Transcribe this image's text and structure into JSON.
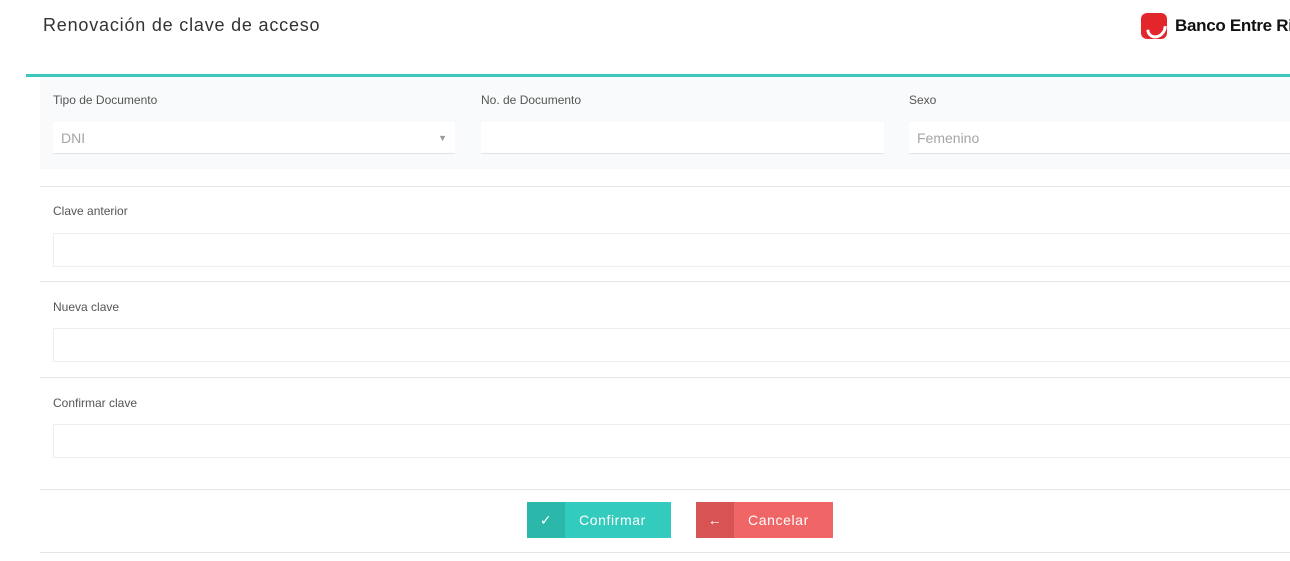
{
  "header": {
    "title": "Renovación de clave de acceso",
    "brand_name": "Banco Entre Ri",
    "brand_color": "#e3262b"
  },
  "accent_color": "#3ec7bd",
  "document_card": {
    "tipo_label": "Tipo de Documento",
    "tipo_value": "DNI",
    "numero_label": "No. de Documento",
    "numero_value": "",
    "sexo_label": "Sexo",
    "sexo_value": "Femenino"
  },
  "passwords": {
    "old_label": "Clave anterior",
    "new_label": "Nueva clave",
    "confirm_label": "Confirmar clave"
  },
  "actions": {
    "confirm_label": "Confirmar",
    "confirm_icon": "checkmark-icon",
    "confirm_color": "#33cbbd",
    "cancel_label": "Cancelar",
    "cancel_icon": "arrow-left-icon",
    "cancel_color": "#f06566"
  }
}
